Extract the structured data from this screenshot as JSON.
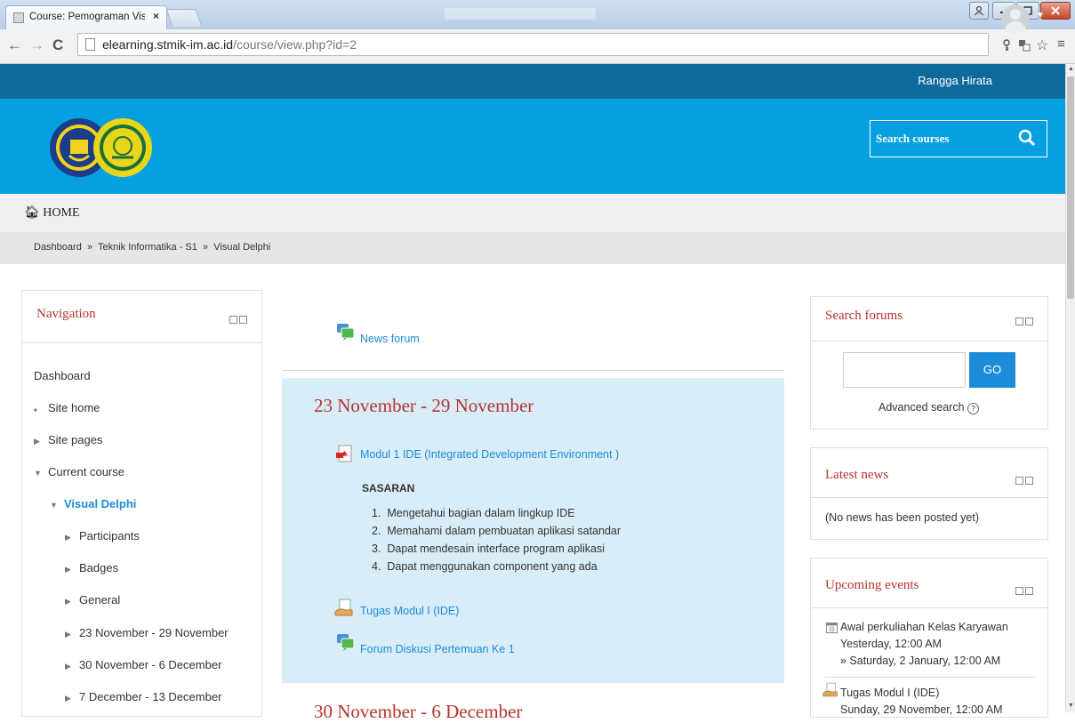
{
  "browser": {
    "tab_title": "Course: Pemograman Visu",
    "tab_close": "×",
    "url_host": "elearning.stmik-im.ac.id",
    "url_path": "/course/view.php?id=2"
  },
  "user": {
    "name": "Rangga Hirata"
  },
  "header": {
    "search_placeholder": "Search courses"
  },
  "nav": {
    "home": "HOME",
    "breadcrumb": [
      "Dashboard",
      "Teknik Informatika - S1",
      "Visual Delphi"
    ],
    "sep": "»"
  },
  "navigation_block": {
    "title": "Navigation",
    "items": [
      {
        "label": "Dashboard",
        "marker": ""
      },
      {
        "label": "Site home",
        "marker": "■"
      },
      {
        "label": "Site pages",
        "marker": "▶"
      },
      {
        "label": "Current course",
        "marker": "▼"
      },
      {
        "label": "Visual Delphi",
        "marker": "▼"
      },
      {
        "label": "Participants",
        "marker": "▶"
      },
      {
        "label": "Badges",
        "marker": "▶"
      },
      {
        "label": "General",
        "marker": "▶"
      },
      {
        "label": "23 November - 29 November",
        "marker": "▶"
      },
      {
        "label": "30 November - 6 December",
        "marker": "▶"
      },
      {
        "label": "7 December - 13 December",
        "marker": "▶"
      }
    ]
  },
  "main": {
    "news_forum": "News forum",
    "section1": {
      "title": "23 November - 29 November",
      "module_link": "Modul 1 IDE (Integrated Development Environment )",
      "sasaran_title": "SASARAN",
      "sasaran_items": [
        "Mengetahui bagian dalam lingkup IDE",
        "Memahami dalam pembuatan aplikasi satandar",
        "Dapat mendesain interface program aplikasi",
        "Dapat menggunakan component yang ada"
      ],
      "assignment_link": "Tugas Modul I (IDE)",
      "forum_link": "Forum Diskusi Pertemuan Ke 1"
    },
    "section2_title": "30 November - 6 December"
  },
  "search_forums": {
    "title": "Search forums",
    "go_label": "GO",
    "advanced": "Advanced search"
  },
  "latest_news": {
    "title": "Latest news",
    "empty": "(No news has been posted yet)"
  },
  "upcoming_events": {
    "title": "Upcoming events",
    "events": [
      {
        "title": "Awal perkuliahan Kelas Karyawan",
        "line1": "Yesterday, 12:00 AM",
        "line2": "» Saturday, 2 January, 12:00 AM"
      },
      {
        "title": "Tugas Modul I (IDE)",
        "line1": "Sunday, 29 November, 12:00 AM"
      }
    ]
  },
  "colors": {
    "header_blue": "#06a0e0",
    "topbar_blue": "#0e6a9a",
    "heading_red": "#b5332e",
    "link_blue": "#1a8cd8",
    "section_bg": "#d8edf7"
  }
}
